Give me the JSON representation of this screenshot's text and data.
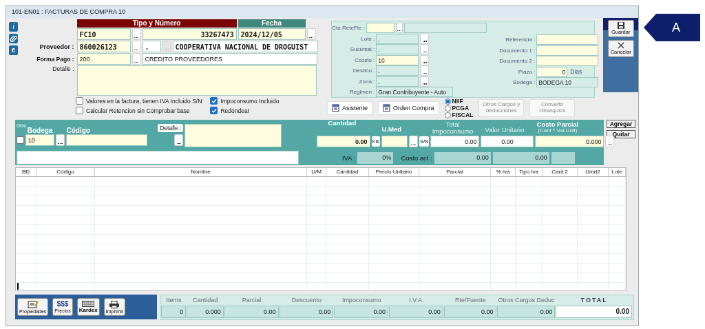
{
  "window": {
    "title": "101-EN01 : FACTURAS DE COMPRA 10"
  },
  "side_buttons": [
    {
      "kind": "info",
      "glyph": "i"
    },
    {
      "kind": "clip"
    },
    {
      "kind": "web",
      "glyph": "e"
    }
  ],
  "header": {
    "tipo_numero_label": "Tipo y Número",
    "fecha_label": "Fecha",
    "tipo": "FC10",
    "numero": "33267473",
    "fecha": "2024/12/05"
  },
  "proveedor": {
    "label": "Proveedor :",
    "code": "860026123",
    "suffix": ".",
    "name": "COOPERATIVA NACIONAL DE DROGUIST"
  },
  "forma_pago": {
    "label": "Forma Pago :",
    "code": "200",
    "name": "CREDITO PROVEEDORES"
  },
  "detalle": {
    "label": "Detalle :"
  },
  "options_left": [
    {
      "label": "Valores en la factura, tienen  IVA Incluido S/N",
      "checked": false
    },
    {
      "label": "Calcular Retencion sin Comprobar base",
      "checked": false
    }
  ],
  "options_right": [
    {
      "label": "Impoconsumo Incluido",
      "checked": true
    },
    {
      "label": "Redondear",
      "checked": true
    }
  ],
  "panel_left": [
    {
      "label": "Cta ReteFte :",
      "editable": true,
      "browse": true
    },
    {
      "label": "Lote :",
      "value": ".",
      "editable": false,
      "browse": true
    },
    {
      "label": "Sucursal :",
      "value": ".",
      "editable": false,
      "browse": true
    },
    {
      "label": "Ccosto :",
      "value": "10",
      "editable": true,
      "browse": true
    },
    {
      "label": "Destino :",
      "value": ".",
      "editable": false,
      "browse": true
    },
    {
      "label": "Zona :",
      "value": ".",
      "editable": false,
      "browse": true
    },
    {
      "label": "Regimen :",
      "value": "Gran Contribuyente - Auto",
      "editable": false,
      "browse": false
    }
  ],
  "panel_right": [
    {
      "label": "Referencia :",
      "editable": true
    },
    {
      "label": "Documento 1 :",
      "editable": true
    },
    {
      "label": "Documento 2 :",
      "editable": true
    },
    {
      "label": "Plazo :",
      "value": "0",
      "editable": true,
      "unit": "Dias"
    },
    {
      "label": "Bodega :",
      "value": "BODEGA 10",
      "editable": false
    }
  ],
  "actions": [
    {
      "label": "Asistente",
      "disabled": false
    },
    {
      "label": "Orden Compra",
      "disabled": false
    }
  ],
  "norms": [
    {
      "label": "NIIF",
      "selected": true
    },
    {
      "label": "PCGA",
      "selected": false
    },
    {
      "label": "FISCAL",
      "selected": false
    }
  ],
  "actions2": [
    {
      "label": "Otros Cargos y deducciones",
      "disabled": true
    },
    {
      "label": "Convertir Obsequios",
      "disabled": true
    }
  ],
  "toolbar": [
    {
      "kind": "save",
      "label": "Guardar"
    },
    {
      "kind": "cancel",
      "label": "Cancelar"
    }
  ],
  "entry": {
    "obs_label": "Obs",
    "obs_checked": false,
    "bodega_label": "Bodega",
    "codigo_label": "Código",
    "detalle_label": "Detalle :",
    "bodega": "10",
    "cantidad_label": "Cantidad",
    "umed_label": "U.Med",
    "impo_label": "Total Impoconsumo",
    "valor_label": "Valor Unitario",
    "costo_label": "Costo Parcial",
    "costo_sub": "(Cant * Val.Unit)",
    "cantidad": "0.00",
    "unit": "Kls",
    "sn": "S/N",
    "impoconsumo": "0.00",
    "valor": "0.00",
    "costo": "0.000",
    "iva_label": "IVA :",
    "iva": "0%",
    "costo_act_label": "Costo act :",
    "costo_act": "0.00",
    "costo_act2": "0.00"
  },
  "entry_buttons": [
    "Agregar",
    "Quitar"
  ],
  "table": {
    "columns": [
      "BD",
      "Código",
      "Nombre",
      "U/M",
      "Cantidad",
      "Precio Unitario",
      "Parcial",
      "% Iva",
      "Tipo Iva",
      "Cant.2",
      "Umd2",
      "Lote"
    ]
  },
  "bottom_buttons": [
    {
      "kind": "props",
      "label": "Propiedades"
    },
    {
      "kind": "prices",
      "label": "Precios",
      "glyph": "$$$"
    },
    {
      "kind": "kardex",
      "label": "Kardex"
    },
    {
      "kind": "print",
      "label": "Imprimir"
    }
  ],
  "totals": [
    {
      "label": "Items",
      "value": "0"
    },
    {
      "label": "Cantidad",
      "value": "0.000"
    },
    {
      "label": "Parcial",
      "value": "0.00"
    },
    {
      "label": "Descuento",
      "value": "0.00"
    },
    {
      "label": "Impoconsumo",
      "value": "0.00"
    },
    {
      "label": "I.V.A.",
      "value": "0.00"
    },
    {
      "label": "Rte/Fuente",
      "value": "0.00"
    },
    {
      "label": "Otros Cargos Deduc",
      "value": "0.00"
    },
    {
      "label": "TOTAL",
      "value": "0.00",
      "kind": "grand"
    }
  ],
  "callout": "A"
}
